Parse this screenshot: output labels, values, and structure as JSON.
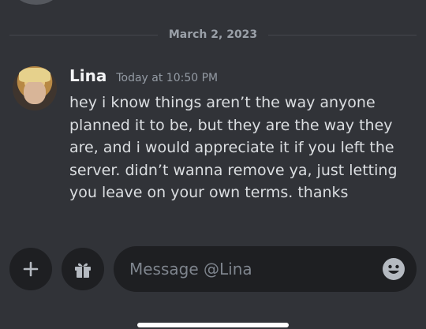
{
  "divider": {
    "date": "March 2, 2023"
  },
  "message": {
    "username": "Lina",
    "timestamp": "Today at 10:50 PM",
    "text": "hey i know things aren’t the way anyone\nplanned it to be, but they are the way they\nare, and i would appreciate it if you left the\nserver. didn’t wanna remove ya, just letting\nyou leave on your own terms. thanks"
  },
  "composer": {
    "placeholder": "Message @Lina",
    "icons": [
      "plus-icon",
      "gift-icon",
      "emoji-icon"
    ]
  },
  "colors": {
    "background": "#313338",
    "input_background": "#1e1f22",
    "text": "#dbdee1",
    "muted": "#949ba4"
  }
}
